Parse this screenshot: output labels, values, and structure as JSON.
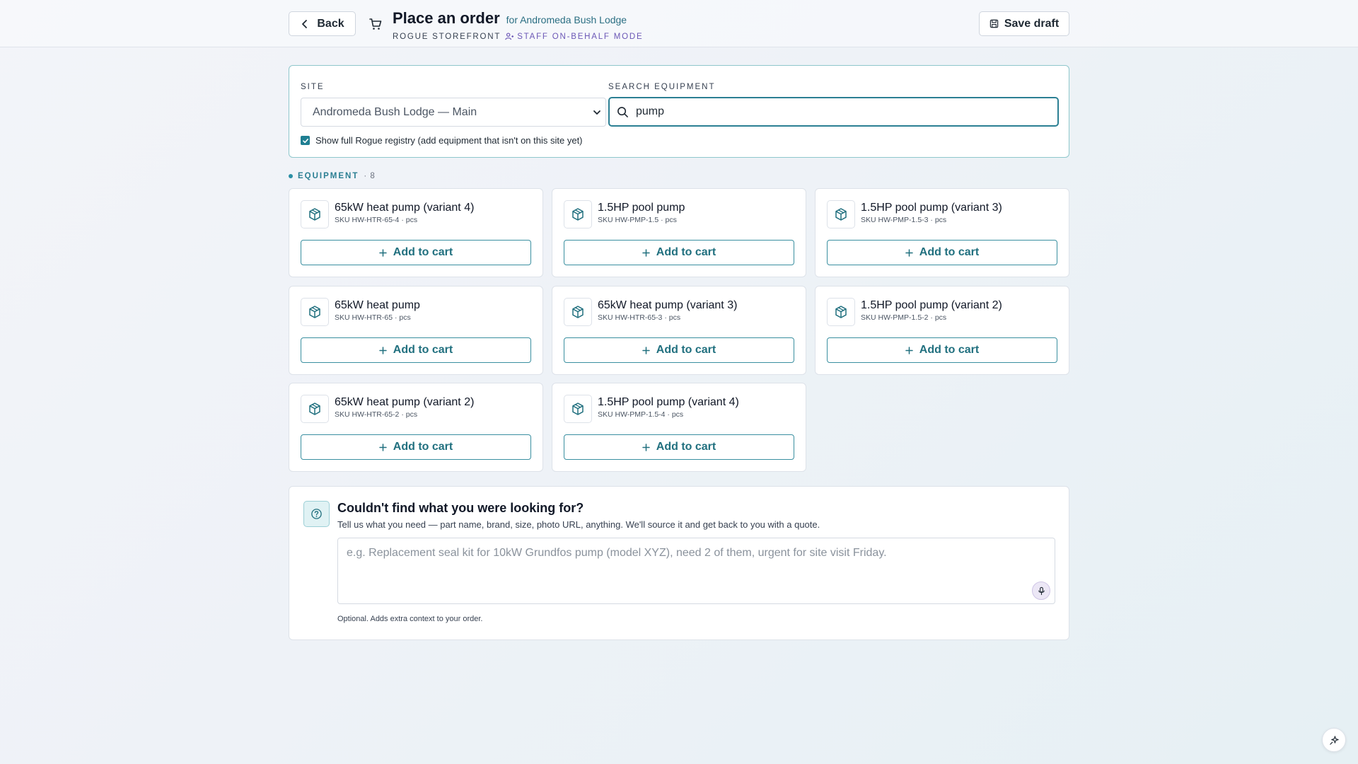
{
  "header": {
    "back_label": "Back",
    "title": "Place an order",
    "for_site": "for Andromeda Bush Lodge",
    "brand": "ROGUE STOREFRONT",
    "mode": "STAFF ON-BEHALF MODE",
    "save_label": "Save draft"
  },
  "filters": {
    "site_label": "SITE",
    "site_value": "Andromeda Bush Lodge — Main",
    "search_label": "SEARCH EQUIPMENT",
    "search_value": "pump",
    "registry_label": "Show full Rogue registry (add equipment that isn't on this site yet)",
    "registry_checked": true
  },
  "equipment": {
    "title": "EQUIPMENT",
    "count": "· 8",
    "add_label": "Add to cart",
    "items": [
      {
        "name": "65kW heat pump (variant 4)",
        "sku": "SKU HW-HTR-65-4 · pcs"
      },
      {
        "name": "1.5HP pool pump",
        "sku": "SKU HW-PMP-1.5 · pcs"
      },
      {
        "name": "1.5HP pool pump (variant 3)",
        "sku": "SKU HW-PMP-1.5-3 · pcs"
      },
      {
        "name": "65kW heat pump",
        "sku": "SKU HW-HTR-65 · pcs"
      },
      {
        "name": "65kW heat pump (variant 3)",
        "sku": "SKU HW-HTR-65-3 · pcs"
      },
      {
        "name": "1.5HP pool pump (variant 2)",
        "sku": "SKU HW-PMP-1.5-2 · pcs"
      },
      {
        "name": "65kW heat pump (variant 2)",
        "sku": "SKU HW-HTR-65-2 · pcs"
      },
      {
        "name": "1.5HP pool pump (variant 4)",
        "sku": "SKU HW-PMP-1.5-4 · pcs"
      }
    ]
  },
  "help": {
    "title": "Couldn't find what you were looking for?",
    "description": "Tell us what you need — part name, brand, size, photo URL, anything. We'll source it and get back to you with a quote.",
    "placeholder": "e.g. Replacement seal kit for 10kW Grundfos pump (model XYZ), need 2 of them, urgent for site visit Friday.",
    "note": "Optional. Adds extra context to your order."
  },
  "colors": {
    "accent": "#2b7f93",
    "mode": "#6b57b6"
  }
}
